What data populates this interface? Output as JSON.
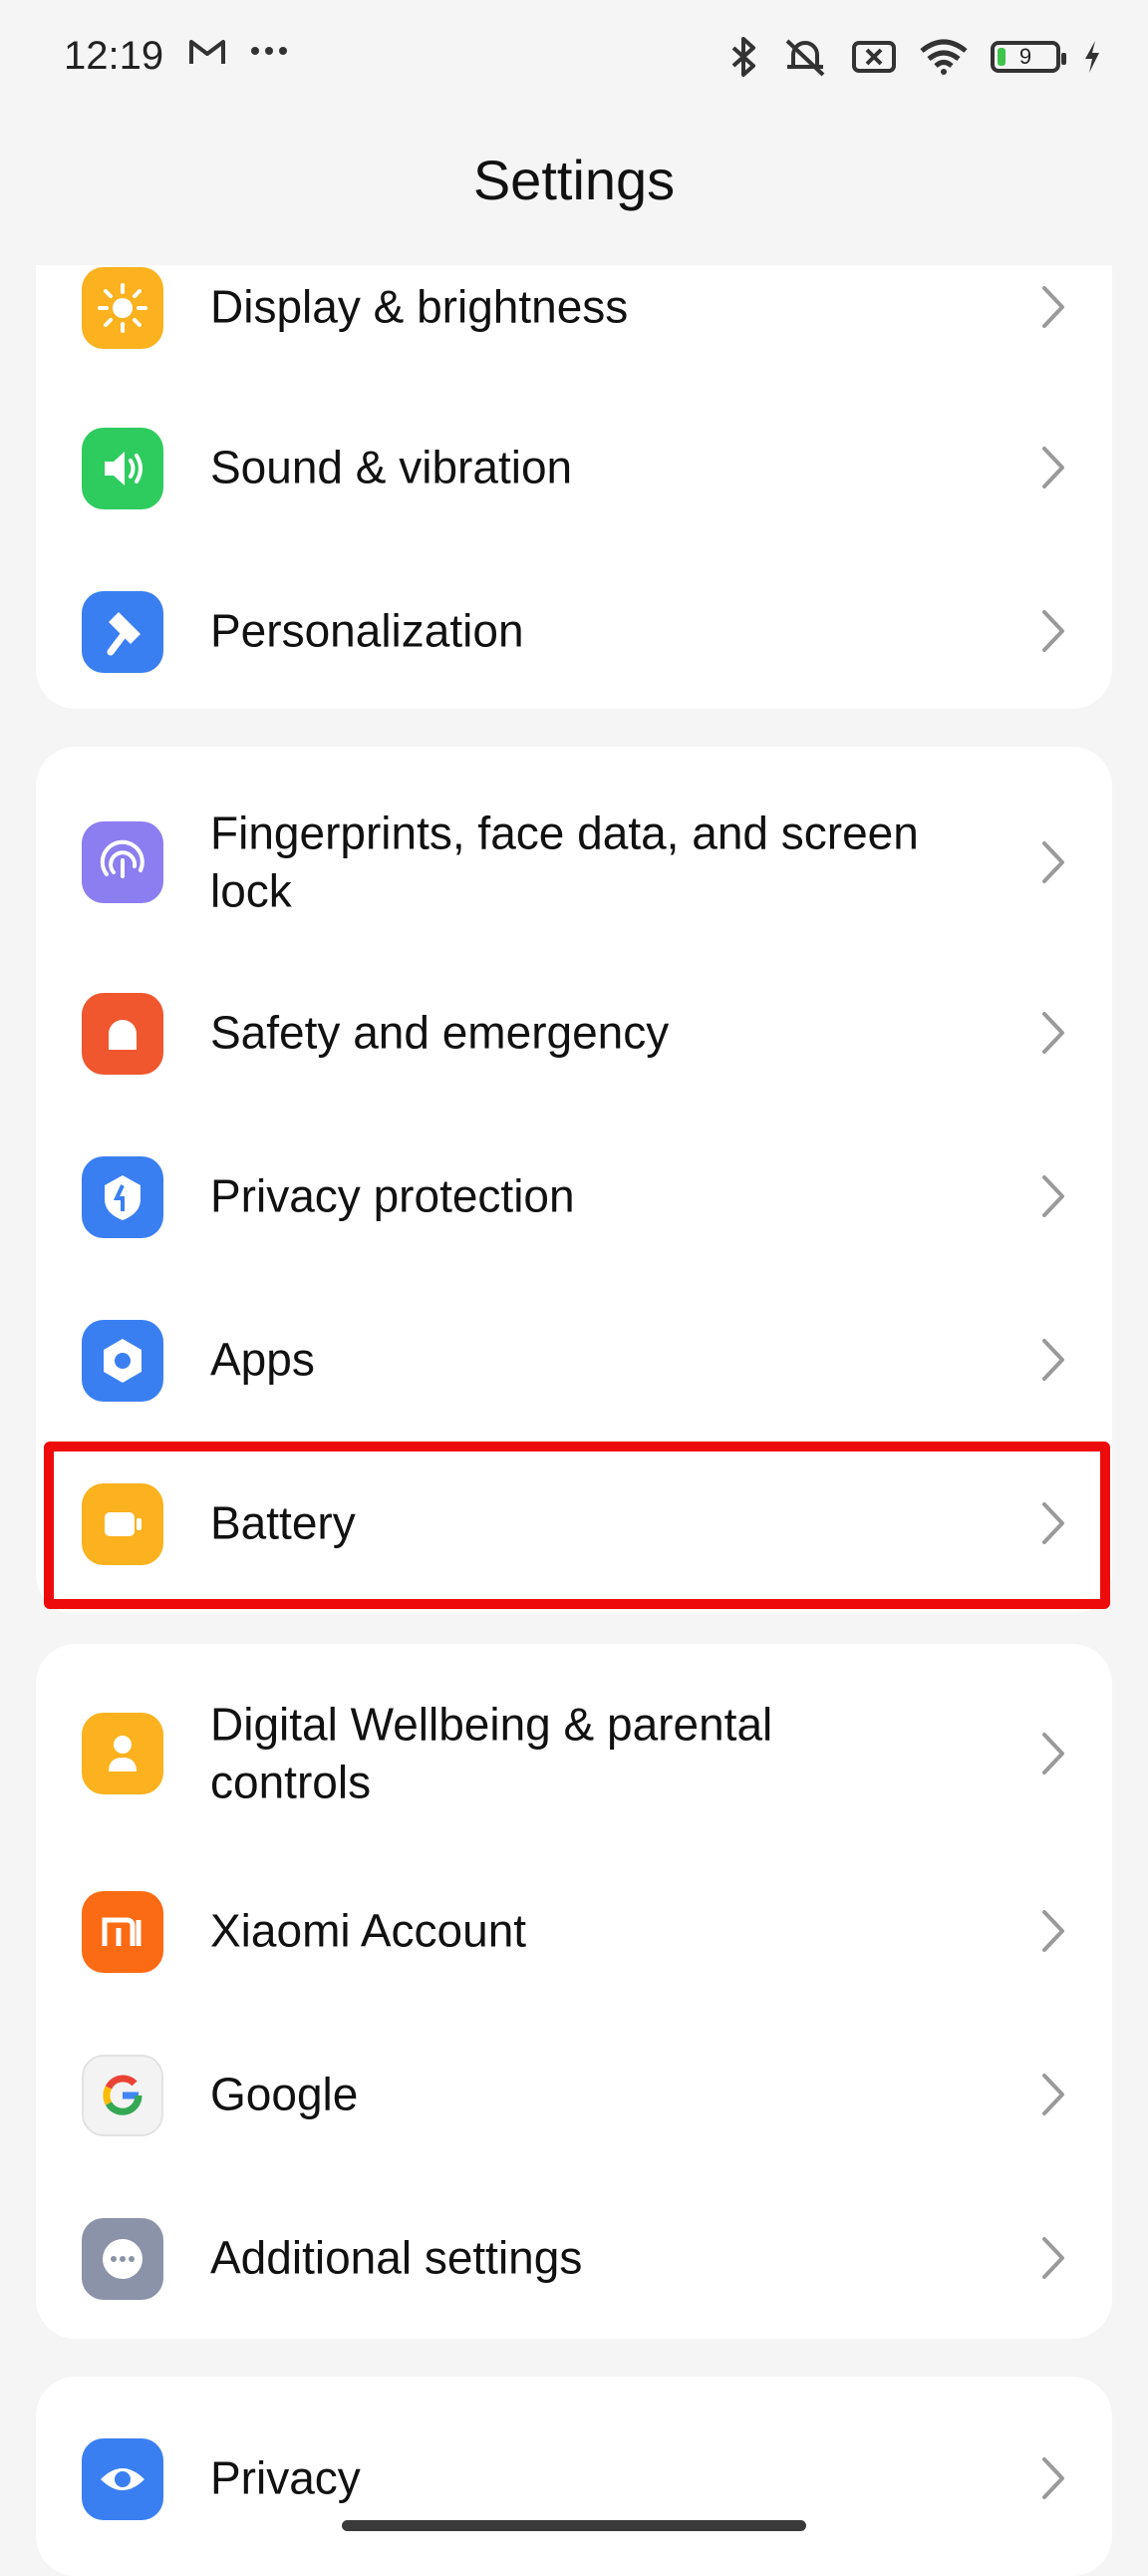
{
  "status_bar": {
    "time": "12:19",
    "battery_level": "9"
  },
  "header": {
    "title": "Settings"
  },
  "groups": [
    {
      "items": [
        {
          "label": "Display & brightness",
          "icon": "sun-icon",
          "color": "#fbb21e"
        },
        {
          "label": "Sound & vibration",
          "icon": "speaker-icon",
          "color": "#2ecc5e"
        },
        {
          "label": "Personalization",
          "icon": "brush-icon",
          "color": "#3a7ff2"
        }
      ]
    },
    {
      "items": [
        {
          "label": "Fingerprints, face data, and screen lock",
          "icon": "fingerprint-icon",
          "color": "#8c7ef0"
        },
        {
          "label": "Safety and emergency",
          "icon": "alarm-icon",
          "color": "#f0572f"
        },
        {
          "label": "Privacy protection",
          "icon": "shield-icon",
          "color": "#3a7ff2"
        },
        {
          "label": "Apps",
          "icon": "apps-gear-icon",
          "color": "#3a7ff2"
        },
        {
          "label": "Battery",
          "icon": "battery-icon",
          "color": "#fbb21e"
        }
      ]
    },
    {
      "items": [
        {
          "label": "Digital Wellbeing & parental controls",
          "icon": "wellbeing-icon",
          "color": "#fbb21e"
        },
        {
          "label": "Xiaomi Account",
          "icon": "mi-logo-icon",
          "color": "#fb6b14"
        },
        {
          "label": "Google",
          "icon": "google-g-icon",
          "color": "#f3f3f3"
        },
        {
          "label": "Additional settings",
          "icon": "more-dots-icon",
          "color": "#8b93a8"
        }
      ]
    },
    {
      "items": [
        {
          "label": "Privacy",
          "icon": "eye-icon",
          "color": "#3a7ff2"
        }
      ]
    }
  ],
  "highlight_color": "#ee0b0b"
}
